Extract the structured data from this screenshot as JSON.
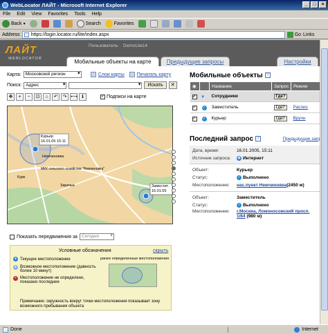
{
  "window": {
    "title": "WebLocator ЛАЙТ - Microsoft Internet Explorer"
  },
  "menu": [
    "File",
    "Edit",
    "View",
    "Favorites",
    "Tools",
    "Help"
  ],
  "toolbar": {
    "back": "Back",
    "search": "Search",
    "favorites": "Favorites"
  },
  "address": {
    "label": "Address",
    "url": "https://login.locator.ru/lite/index.aspx",
    "go": "Go",
    "links": "Links"
  },
  "site": {
    "logo": "ЛАЙТ",
    "logo_sub": "WEBLOCATOR",
    "user_label": "Пользователь:",
    "user_name": "DemoLite14",
    "tabs": [
      "Мобильные объекты на карте",
      "Предыдущие запросы",
      "Настройки"
    ]
  },
  "map_panel": {
    "map_label": "Карта:",
    "map_value": "Московский регион",
    "layers_link": "Слои карты",
    "print_link": "Печатать карту",
    "search_label": "Поиск:",
    "search_type": "Адрес",
    "search_button": "Искать",
    "signatures_label": "Подписи на карте",
    "labels": {
      "courier_name": "Курьер",
      "courier_date": "16.01.05 15:11",
      "deputy_name": "Заместит.",
      "deputy_date": "16.01.05",
      "neme": "Немчиновка",
      "kurk": "Курк",
      "zarech": "Заречье",
      "ugol": "МКК сельского хозяйства \"Немчиновка\""
    },
    "show_moves_label": "Показать передвижения за",
    "show_moves_value": "Сегодня"
  },
  "legend": {
    "title": "Условные обозначения",
    "hide": "скрыть",
    "items": [
      "Текущее местоположение",
      "Возможное местоположение (давность более 10 минут)",
      "Местоположение не определено, показано последнее"
    ],
    "prev_title": "ранее определенные местоположения",
    "note": "Примечание: окружность вокруг точки местоположения показывает зону возможного пребывания объекта"
  },
  "objects": {
    "title": "Мобильные объекты",
    "columns": [
      "Название",
      "Запрос",
      "Режим"
    ],
    "group": "Сотрудники",
    "rows": [
      {
        "name": "Заместитель",
        "request": "Где?",
        "mode": "Распис"
      },
      {
        "name": "Курьер",
        "request": "Где?",
        "mode": "Вручн"
      }
    ]
  },
  "last_request": {
    "title": "Последний запрос",
    "prev_link": "Предыдущие запр",
    "datetime_label": "Дата, время:",
    "datetime": "16.01.2005, 15:11",
    "source_label": "Источник запроса:",
    "source": "Интернет",
    "results": [
      {
        "object_label": "Объект:",
        "object": "Курьер",
        "status_label": "Статус:",
        "status": "Выполнено",
        "location_label": "Местоположение:",
        "location": "нас.пункт Немчиновка",
        "location_extra": " (2450 м)"
      },
      {
        "object_label": "Объект:",
        "object": "Заместитель",
        "status_label": "Статус:",
        "status": "Выполнено",
        "location_label": "Местоположение:",
        "location": "г.Москва, Ломоносовский просп. 1/64",
        "location_extra": " (980 м)"
      }
    ]
  },
  "status": {
    "left": "Done",
    "zone": "Internet"
  }
}
